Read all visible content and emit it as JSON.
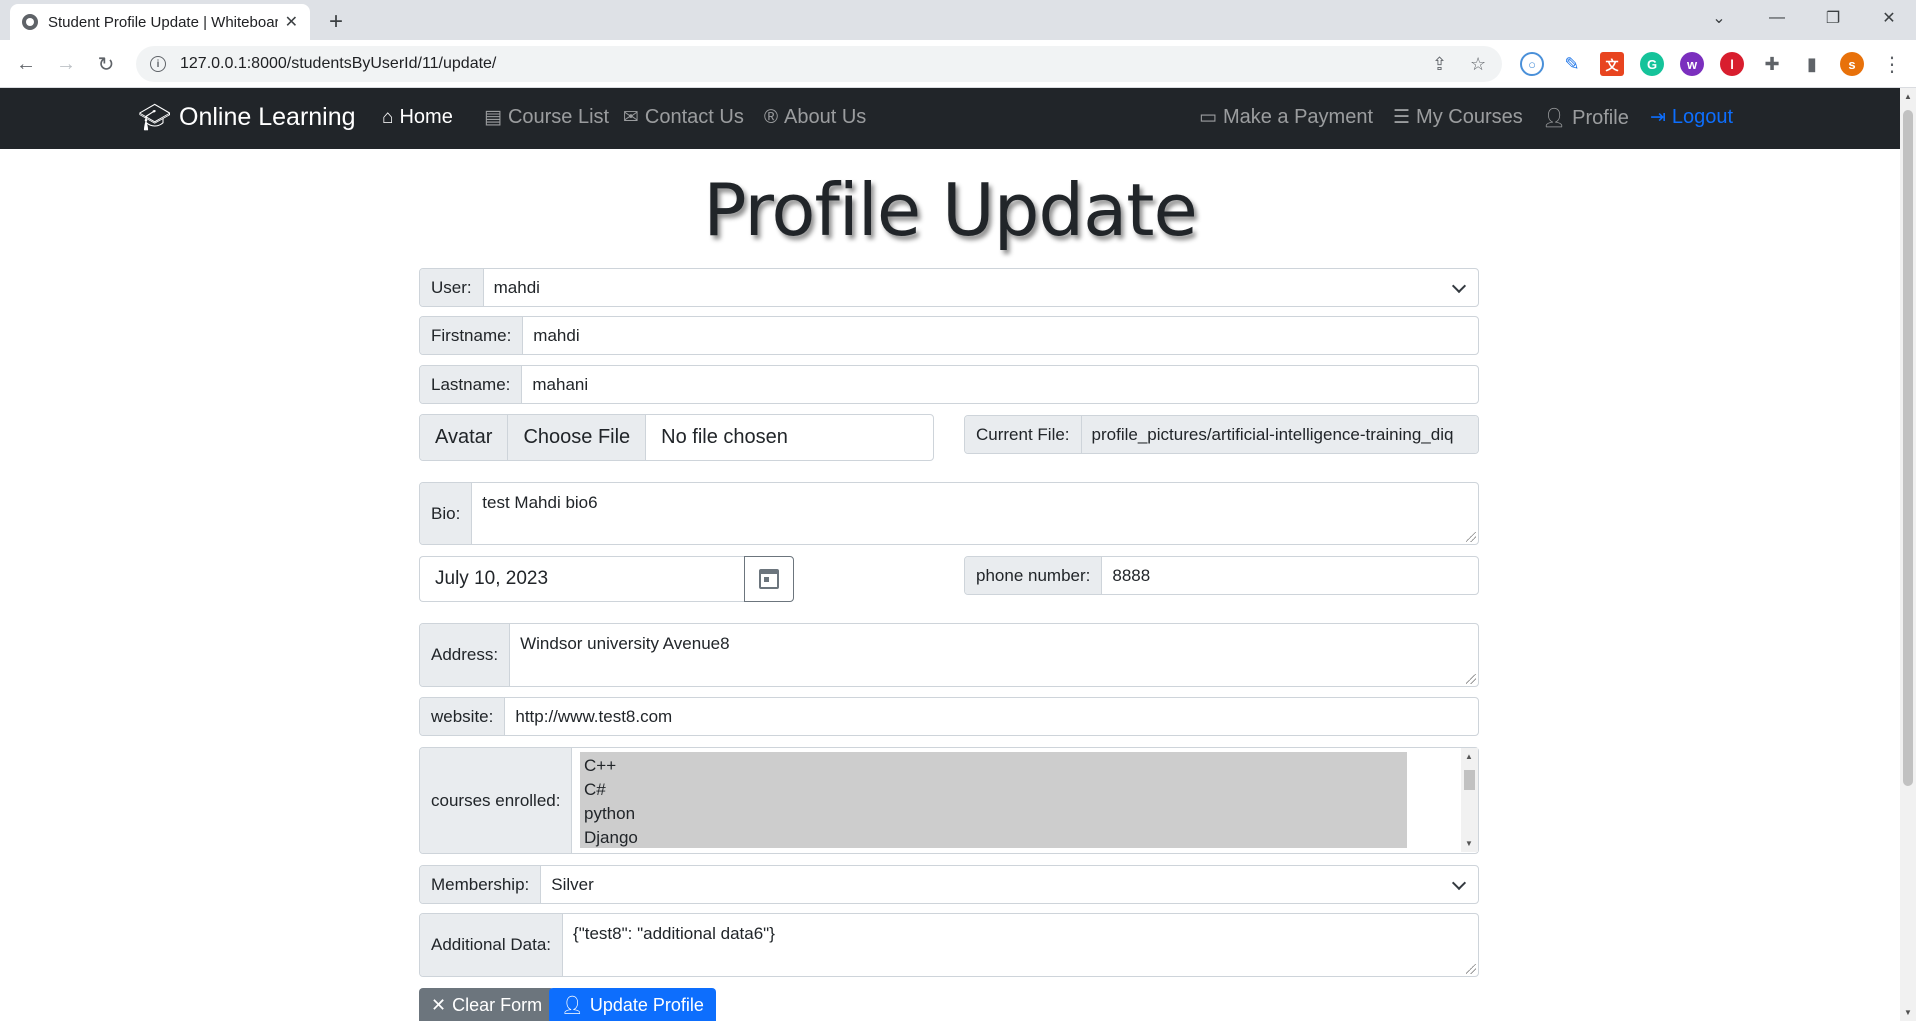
{
  "browser": {
    "tab_title": "Student Profile Update | Whiteboard",
    "url": "127.0.0.1:8000/studentsByUserId/11/update/",
    "profile_initial": "s"
  },
  "navbar": {
    "brand": "Online Learning",
    "links": {
      "home": "Home",
      "course_list": "Course List",
      "contact": "Contact Us",
      "about": "About Us",
      "payment": "Make a Payment",
      "my_courses": "My Courses",
      "profile": "Profile",
      "logout": "Logout"
    }
  },
  "page": {
    "title": "Profile Update"
  },
  "form": {
    "user": {
      "label": "User:",
      "value": "mahdi"
    },
    "firstname": {
      "label": "Firstname:",
      "value": "mahdi"
    },
    "lastname": {
      "label": "Lastname:",
      "value": "mahani"
    },
    "avatar": {
      "label": "Avatar",
      "button": "Choose File",
      "filename": "No file chosen"
    },
    "current_file": {
      "label": "Current File:",
      "value": "profile_pictures/artificial-intelligence-training_diq"
    },
    "bio": {
      "label": "Bio:",
      "value": "test Mahdi bio6"
    },
    "birthdate": {
      "value": "July 10, 2023"
    },
    "phone": {
      "label": "phone number:",
      "value": "8888"
    },
    "address": {
      "label": "Address:",
      "value": "Windsor university Avenue8"
    },
    "website": {
      "label": "website:",
      "value": "http://www.test8.com"
    },
    "courses": {
      "label": "courses enrolled:",
      "options": [
        "C++",
        "C#",
        "python",
        "Django"
      ]
    },
    "membership": {
      "label": "Membership:",
      "value": "Silver"
    },
    "additional": {
      "label": "Additional Data:",
      "value": "{\"test8\": \"additional data6\"}"
    }
  },
  "buttons": {
    "clear": "Clear Form",
    "update": "Update Profile"
  },
  "colors": {
    "navbar_bg": "#212529",
    "primary": "#0d6efd",
    "secondary": "#6c757d"
  }
}
